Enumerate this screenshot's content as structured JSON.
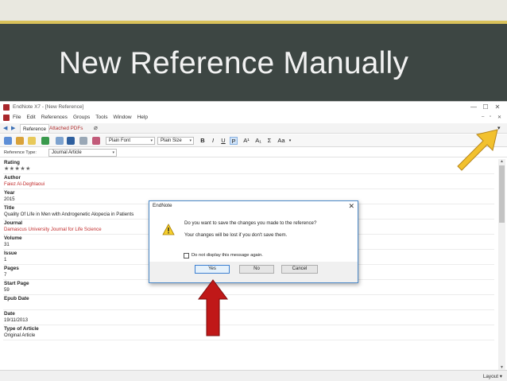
{
  "slide": {
    "title": "New Reference Manually"
  },
  "window": {
    "title": "EndNote X7 - [New Reference]",
    "controls": {
      "minimize": "—",
      "maximize": "☐",
      "close": "✕"
    }
  },
  "menubar": {
    "items": [
      "File",
      "Edit",
      "References",
      "Groups",
      "Tools",
      "Window",
      "Help"
    ],
    "mdi": [
      "–",
      "▫",
      "✕"
    ]
  },
  "tabs": {
    "reference": "Reference",
    "pdfs": "Attached PDFs"
  },
  "toolbar": {
    "font": "Plain Font",
    "size": "Plain Size",
    "bold": "B",
    "italic": "I",
    "underline": "U",
    "plain": "P",
    "superscript": "A¹",
    "subscript": "A₁",
    "symbol": "Σ",
    "case": "Aa"
  },
  "reference_type": {
    "label": "Reference Type:",
    "value": "Journal Article"
  },
  "fields": {
    "rating": {
      "label": "Rating",
      "stars": "★★★★★"
    },
    "author": {
      "label": "Author",
      "value": "Faiez Al-Deghlaoui"
    },
    "year": {
      "label": "Year",
      "value": "2015"
    },
    "title": {
      "label": "Title",
      "value": "Quality Of Life in Men with Androgenetic Alopecia in Patients"
    },
    "journal": {
      "label": "Journal",
      "value": "Damascus University Journal for Life Science"
    },
    "volume": {
      "label": "Volume",
      "value": "31"
    },
    "issue": {
      "label": "Issue",
      "value": "1"
    },
    "pages": {
      "label": "Pages",
      "value": "7"
    },
    "start_page": {
      "label": "Start Page",
      "value": "59"
    },
    "epub_date": {
      "label": "Epub Date",
      "value": ""
    },
    "date": {
      "label": "Date",
      "value": "19/11/2013"
    },
    "type_of_article": {
      "label": "Type of Article",
      "value": "Original Article"
    }
  },
  "statusbar": {
    "layout": "Layout"
  },
  "dialog": {
    "title": "EndNote",
    "message": "Do you want to save the changes you made to the reference?",
    "detail": "Your changes will be lost if you don't save them.",
    "checkbox_label": "Do not display this message again.",
    "buttons": {
      "yes": "Yes",
      "no": "No",
      "cancel": "Cancel"
    }
  },
  "colors": {
    "slide_background": "#3d4643",
    "accent_band": "#d9c15a",
    "red_value": "#c22d2d",
    "callout_yellow": "#f2c12e",
    "callout_red": "#c01818"
  }
}
